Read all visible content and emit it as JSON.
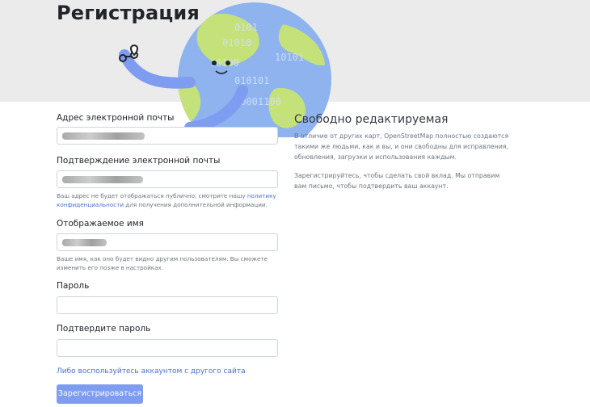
{
  "header": {
    "title": "Регистрация"
  },
  "form": {
    "email_label": "Адрес электронной почты",
    "email_confirm_label": "Подтверждение электронной почты",
    "email_help_prefix": "Ваш адрес не будет отображаться публично, смотрите нашу ",
    "email_help_link": "политику конфиденциальности",
    "email_help_suffix": " для получения дополнительной информации.",
    "display_name_label": "Отображаемое имя",
    "display_name_help": "Ваше имя, как оно будет видно другим пользователям. Вы сможете изменить его позже в настройках.",
    "password_label": "Пароль",
    "password_confirm_label": "Подтвердите пароль",
    "alt_account_link": "Либо воспользуйтесь аккаунтом с другого сайта",
    "submit_label": "Зарегистрироваться"
  },
  "sidebar": {
    "heading": "Свободно редактируемая",
    "para1": "В отличие от других карт, OpenStreetMap полностью создаются такими же людьми, как и вы, и они свободны для исправления, обновления, загрузки и использования каждым.",
    "para2": "Зарегистрируйтесь, чтобы сделать свой вклад. Мы отправим вам письмо, чтобы подтвердить ваш аккаунт."
  },
  "globe_digits": [
    "0101",
    "10100",
    "010101",
    "01010",
    "10101",
    "00001100"
  ],
  "colors": {
    "accent": "#7e9cf0",
    "link": "#4a6fd0",
    "header_bg": "#ebebeb",
    "globe_ocean": "#8fb3ee",
    "globe_land": "#c5e27a"
  }
}
